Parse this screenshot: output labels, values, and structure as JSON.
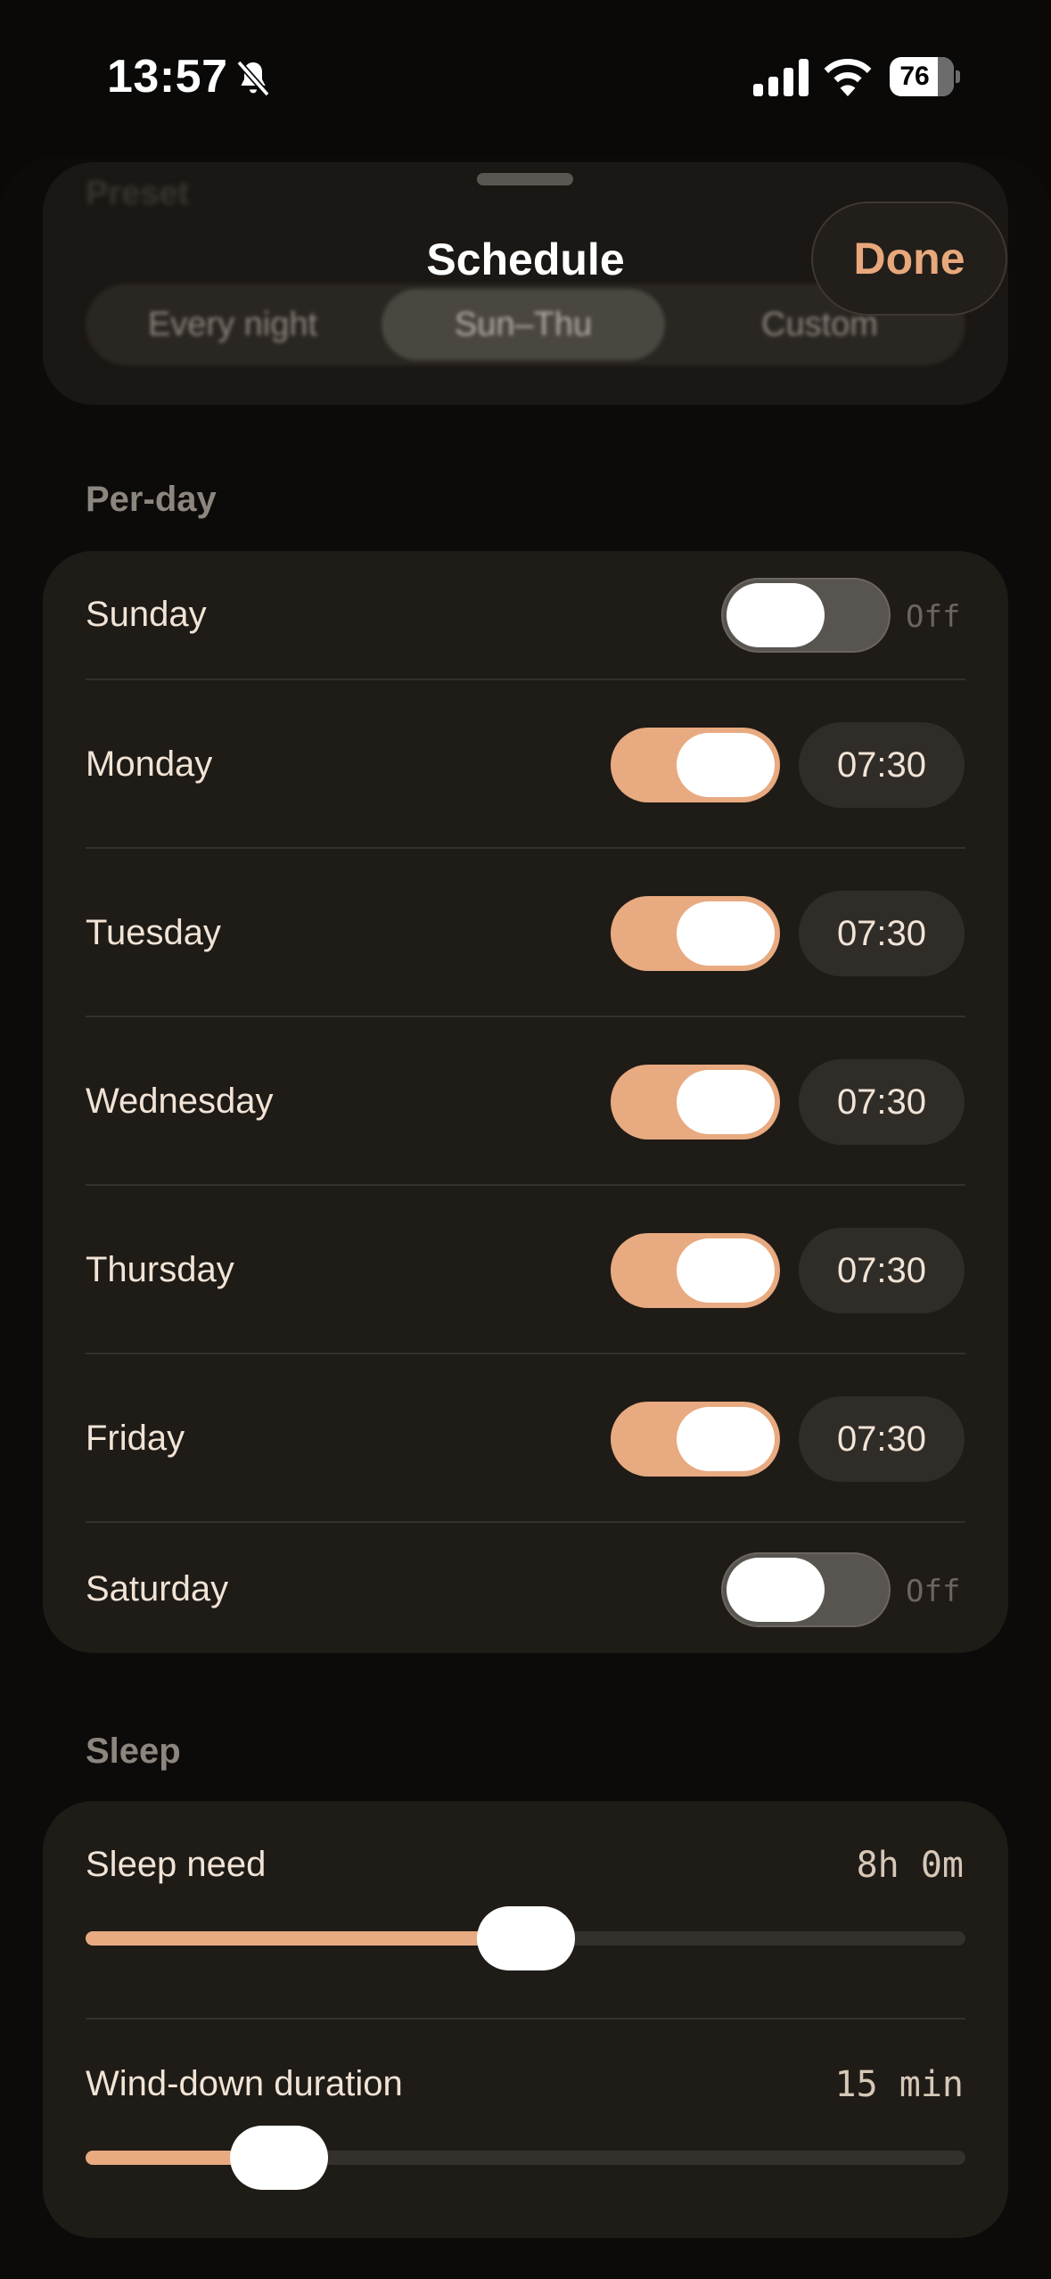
{
  "status_bar": {
    "time": "13:57",
    "battery": "76",
    "battery_level_pct": 76
  },
  "sheet": {
    "title": "Schedule",
    "done_label": "Done"
  },
  "preset": {
    "label": "Preset",
    "options": [
      "Every night",
      "Sun–Thu",
      "Custom"
    ],
    "selected": "Sun–Thu"
  },
  "per_day": {
    "header": "Per-day",
    "days": [
      {
        "name": "Sunday",
        "enabled": false,
        "value": "Off"
      },
      {
        "name": "Monday",
        "enabled": true,
        "value": "07:30"
      },
      {
        "name": "Tuesday",
        "enabled": true,
        "value": "07:30"
      },
      {
        "name": "Wednesday",
        "enabled": true,
        "value": "07:30"
      },
      {
        "name": "Thursday",
        "enabled": true,
        "value": "07:30"
      },
      {
        "name": "Friday",
        "enabled": true,
        "value": "07:30"
      },
      {
        "name": "Saturday",
        "enabled": false,
        "value": "Off"
      }
    ]
  },
  "sleep": {
    "header": "Sleep",
    "sleep_need": {
      "label": "Sleep need",
      "value": "8h 0m",
      "level_fraction": 0.5
    },
    "wind_down": {
      "label": "Wind-down duration",
      "value": "15 min",
      "level_fraction": 0.22
    }
  },
  "colors": {
    "accent": "#e8aa80",
    "background": "#0a0908",
    "card": "#1f1b17"
  },
  "icons": {
    "silent": "bell-slash-icon",
    "signal": "cellular-signal-icon",
    "wifi": "wifi-icon",
    "battery": "battery-icon"
  }
}
